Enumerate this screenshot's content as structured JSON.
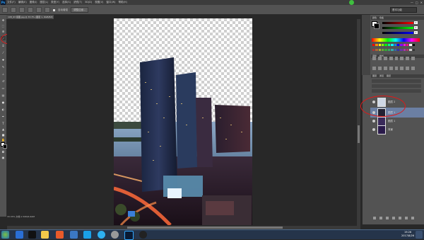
{
  "app": {
    "logo": "Ps"
  },
  "menu": [
    "文件(F)",
    "编辑(E)",
    "图像(I)",
    "图层(L)",
    "类型(Y)",
    "选择(S)",
    "滤镜(T)",
    "3D(D)",
    "视图(V)",
    "窗口(W)",
    "帮助(H)"
  ],
  "window_controls": [
    "—",
    "□",
    "✕"
  ],
  "options_bar": {
    "auto_enhance": "自动增强",
    "refine_edge": "调整边缘...",
    "workspace": "基本功能"
  },
  "document": {
    "tab_title": "108_93 抠图.jpg @ 33.3% (图层 1, RGB/8#) *",
    "status": "33.33%  文档:1.59M/4.60M"
  },
  "panels": {
    "color_tabs": [
      "颜色",
      "色板"
    ],
    "slider_values": [
      "0",
      "0",
      "0"
    ],
    "adjust_tabs": [
      "调整",
      "样式"
    ],
    "layers_tabs": [
      "图层",
      "通道",
      "路径"
    ],
    "layers": [
      {
        "name": "图层 2",
        "selected": false
      },
      {
        "name": "图层 1",
        "selected": true
      },
      {
        "name": "图层 1",
        "selected": false
      },
      {
        "name": "背景",
        "selected": false
      }
    ]
  },
  "taskbar": {
    "time": "19:26",
    "date": "2017/8/26"
  },
  "colors": {
    "selection": "#6b7fa3",
    "annotation": "#e01818",
    "ps_blue": "#31a8ff"
  }
}
